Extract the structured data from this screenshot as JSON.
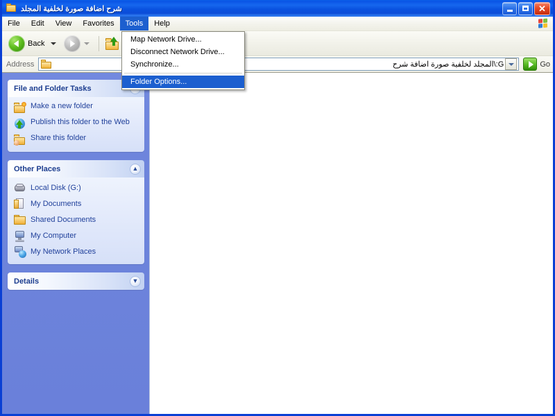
{
  "window": {
    "title": "شرح اضافة صورة لخلفية المجلد",
    "title_icon": "folder-icon",
    "controls": {
      "minimize": "_",
      "maximize": "□",
      "close": "✕"
    }
  },
  "menubar": {
    "items": [
      {
        "label": "File",
        "active": false
      },
      {
        "label": "Edit",
        "active": false
      },
      {
        "label": "View",
        "active": false
      },
      {
        "label": "Favorites",
        "active": false
      },
      {
        "label": "Tools",
        "active": true
      },
      {
        "label": "Help",
        "active": false
      }
    ],
    "brand_icon": "windows-flag-icon"
  },
  "toolbar": {
    "back_label": "Back",
    "back_icon": "back-arrow-icon",
    "forward_icon": "forward-arrow-icon",
    "up_icon": "up-folder-icon"
  },
  "address": {
    "label": "Address",
    "value": "G:\\المجلد لخلفية صورة اضافة شرح",
    "folder_icon": "folder-icon",
    "dropdown_icon": "chevron-down-icon",
    "go_label": "Go",
    "go_icon": "go-arrow-icon"
  },
  "tools_menu": {
    "items": [
      {
        "label": "Map Network Drive...",
        "selected": false,
        "separator_after": false
      },
      {
        "label": "Disconnect Network Drive...",
        "selected": false,
        "separator_after": false
      },
      {
        "label": "Synchronize...",
        "selected": false,
        "separator_after": true
      },
      {
        "label": "Folder Options...",
        "selected": true,
        "separator_after": false
      }
    ]
  },
  "sidebar": {
    "panels": [
      {
        "title": "File and Folder Tasks",
        "chevron": "▲",
        "chevron_icon": "chevron-up-icon",
        "collapsed": false,
        "items": [
          {
            "label": "Make a new folder",
            "icon": "new-folder-icon"
          },
          {
            "label": "Publish this folder to the Web",
            "icon": "publish-web-icon"
          },
          {
            "label": "Share this folder",
            "icon": "share-folder-icon"
          }
        ]
      },
      {
        "title": "Other Places",
        "chevron": "▲",
        "chevron_icon": "chevron-up-icon",
        "collapsed": false,
        "items": [
          {
            "label": "Local Disk (G:)",
            "icon": "hard-disk-icon"
          },
          {
            "label": "My Documents",
            "icon": "my-documents-icon"
          },
          {
            "label": "Shared Documents",
            "icon": "shared-documents-icon"
          },
          {
            "label": "My Computer",
            "icon": "my-computer-icon"
          },
          {
            "label": "My Network Places",
            "icon": "network-places-icon"
          }
        ]
      },
      {
        "title": "Details",
        "chevron": "▼",
        "chevron_icon": "chevron-down-icon",
        "collapsed": true,
        "items": []
      }
    ]
  },
  "colors": {
    "title_blue": "#0A52E0",
    "accent_blue": "#1C5FCF",
    "sidebar_blue": "#6E85DC",
    "panel_header_text": "#1C3D8F",
    "link_text": "#21419B",
    "close_red": "#E64A25",
    "go_green": "#5ABC25"
  }
}
